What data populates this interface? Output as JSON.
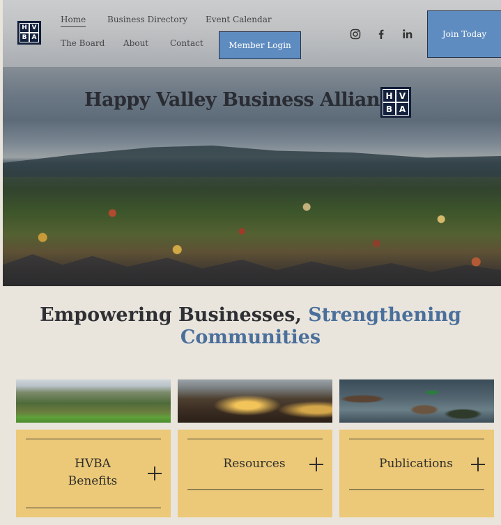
{
  "brand": {
    "logo_letters": [
      "H",
      "V",
      "B",
      "A"
    ],
    "name": "Happy Valley Business Alliance"
  },
  "nav": {
    "items": [
      {
        "label": "Home",
        "active": true
      },
      {
        "label": "Business Directory",
        "active": false
      },
      {
        "label": "Event Calendar",
        "active": false
      },
      {
        "label": "The Board",
        "active": false
      },
      {
        "label": "About",
        "active": false
      },
      {
        "label": "Contact",
        "active": false
      }
    ],
    "member_login": "Member Login",
    "join_today": "Join Today"
  },
  "social": {
    "icons": [
      "instagram-icon",
      "facebook-icon",
      "linkedin-icon"
    ]
  },
  "tagline": {
    "part1": "Empowering Businesses,",
    "part2": "Strengthening",
    "part3": "Communities"
  },
  "cards": [
    {
      "label_line1": "HVBA",
      "label_line2": "Benefits",
      "image": "aerial-valley-photo"
    },
    {
      "label_line1": "Resources",
      "label_line2": "",
      "image": "lit-building-photo"
    },
    {
      "label_line1": "Publications",
      "label_line2": "",
      "image": "ducks-on-water-photo"
    }
  ],
  "colors": {
    "accent_blue": "#5e8cc0",
    "headline_blue": "#4b6f9b",
    "card_gold": "#ecc978",
    "page_bg": "#e9e5dd",
    "logo_navy": "#14213d"
  }
}
